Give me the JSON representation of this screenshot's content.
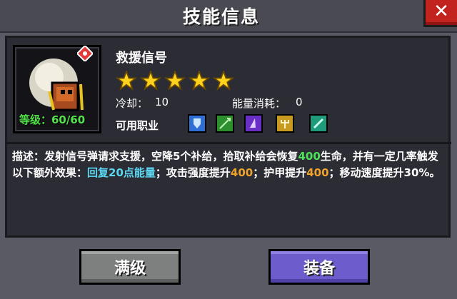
{
  "window": {
    "title": "技能信息"
  },
  "skill": {
    "name": "救援信号",
    "level_label": "等级：60/60",
    "stars": 5,
    "cooldown_label": "冷却：",
    "cooldown_value": "10",
    "energy_label": "能量消耗：",
    "energy_value": "0",
    "classes_label": "可用职业",
    "classes": [
      {
        "icon": "knight-shield-icon",
        "color": "#2f6fd4"
      },
      {
        "icon": "ranger-bow-icon",
        "color": "#2e8f2e"
      },
      {
        "icon": "wizard-hat-icon",
        "color": "#6a2fc4"
      },
      {
        "icon": "priest-trident-icon",
        "color": "#c89a20"
      },
      {
        "icon": "assassin-blade-icon",
        "color": "#1f9a7a"
      }
    ]
  },
  "description": {
    "p1": "描述：发射信号弹请求支援，空降5个补给，拾取补给会恢复",
    "p2": "400",
    "p3": "生命，并有一定几率触发以下额外效果：",
    "p4": "回复20点能量",
    "p5": "；攻击强度提升",
    "p6": "400",
    "p7": "；护甲提升",
    "p8": "400",
    "p9": "；移动速度提升30%。"
  },
  "buttons": {
    "max_level": "满级",
    "equip": "装备"
  },
  "colors": {
    "green": "#4ee35a",
    "cyan": "#5cd8f2",
    "orange": "#f0a32a",
    "close": "#c2231f"
  }
}
